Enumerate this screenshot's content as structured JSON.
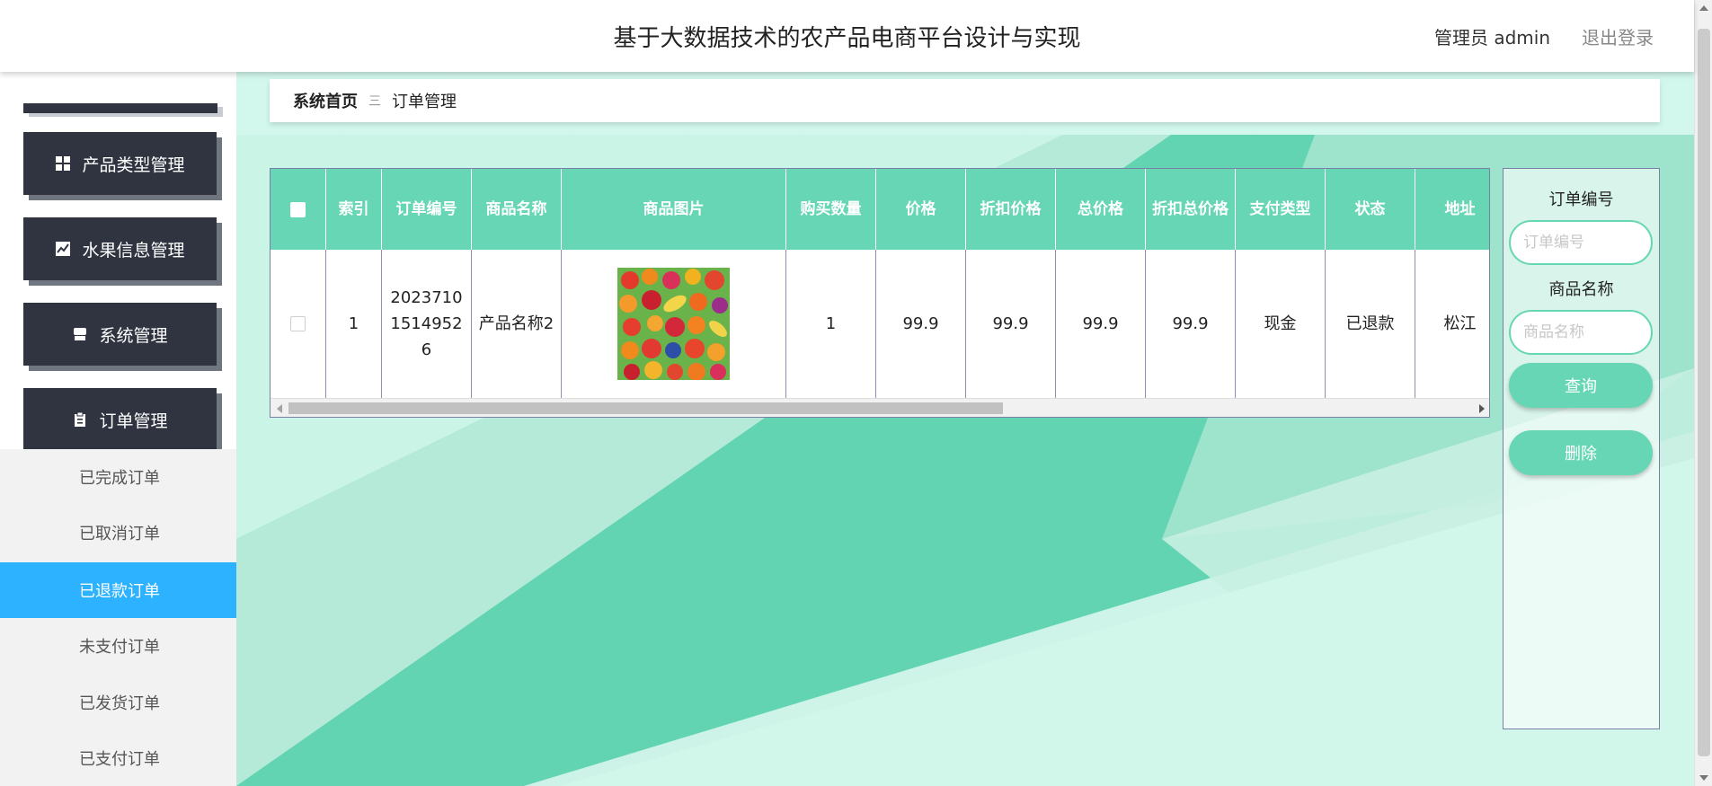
{
  "header": {
    "title": "基于大数据技术的农产品电商平台设计与实现",
    "user_label": "管理员 admin",
    "logout_label": "退出登录"
  },
  "sidebar": {
    "menu": [
      {
        "label": "产品类型管理",
        "icon": "grid-icon"
      },
      {
        "label": "水果信息管理",
        "icon": "chart-icon"
      },
      {
        "label": "系统管理",
        "icon": "store-icon"
      },
      {
        "label": "订单管理",
        "icon": "clipboard-icon"
      }
    ],
    "submenu": [
      {
        "label": "已完成订单",
        "active": false
      },
      {
        "label": "已取消订单",
        "active": false
      },
      {
        "label": "已退款订单",
        "active": true
      },
      {
        "label": "未支付订单",
        "active": false
      },
      {
        "label": "已发货订单",
        "active": false
      },
      {
        "label": "已支付订单",
        "active": false
      }
    ]
  },
  "breadcrumb": {
    "home": "系统首页",
    "separator": "三",
    "current": "订单管理"
  },
  "table": {
    "columns": [
      "索引",
      "订单编号",
      "商品名称",
      "商品图片",
      "购买数量",
      "价格",
      "折扣价格",
      "总价格",
      "折扣总价格",
      "支付类型",
      "状态",
      "地址"
    ],
    "rows": [
      {
        "index": "1",
        "order_no": "20237101514952 6",
        "product_name": "产品名称2",
        "product_image": "fruit-assortment-image",
        "quantity": "1",
        "price": "99.9",
        "discount_price": "99.9",
        "total_price": "99.9",
        "discount_total": "99.9",
        "pay_type": "现金",
        "status": "已退款",
        "address": "松江"
      }
    ]
  },
  "search": {
    "order_no_label": "订单编号",
    "order_no_placeholder": "订单编号",
    "order_no_value": "",
    "product_name_label": "商品名称",
    "product_name_placeholder": "商品名称",
    "product_name_value": "",
    "query_label": "查询",
    "delete_label": "删除"
  },
  "colors": {
    "accent": "#67d6b4",
    "menu_dark": "#2f3440",
    "submenu_active": "#2cb2ff"
  }
}
